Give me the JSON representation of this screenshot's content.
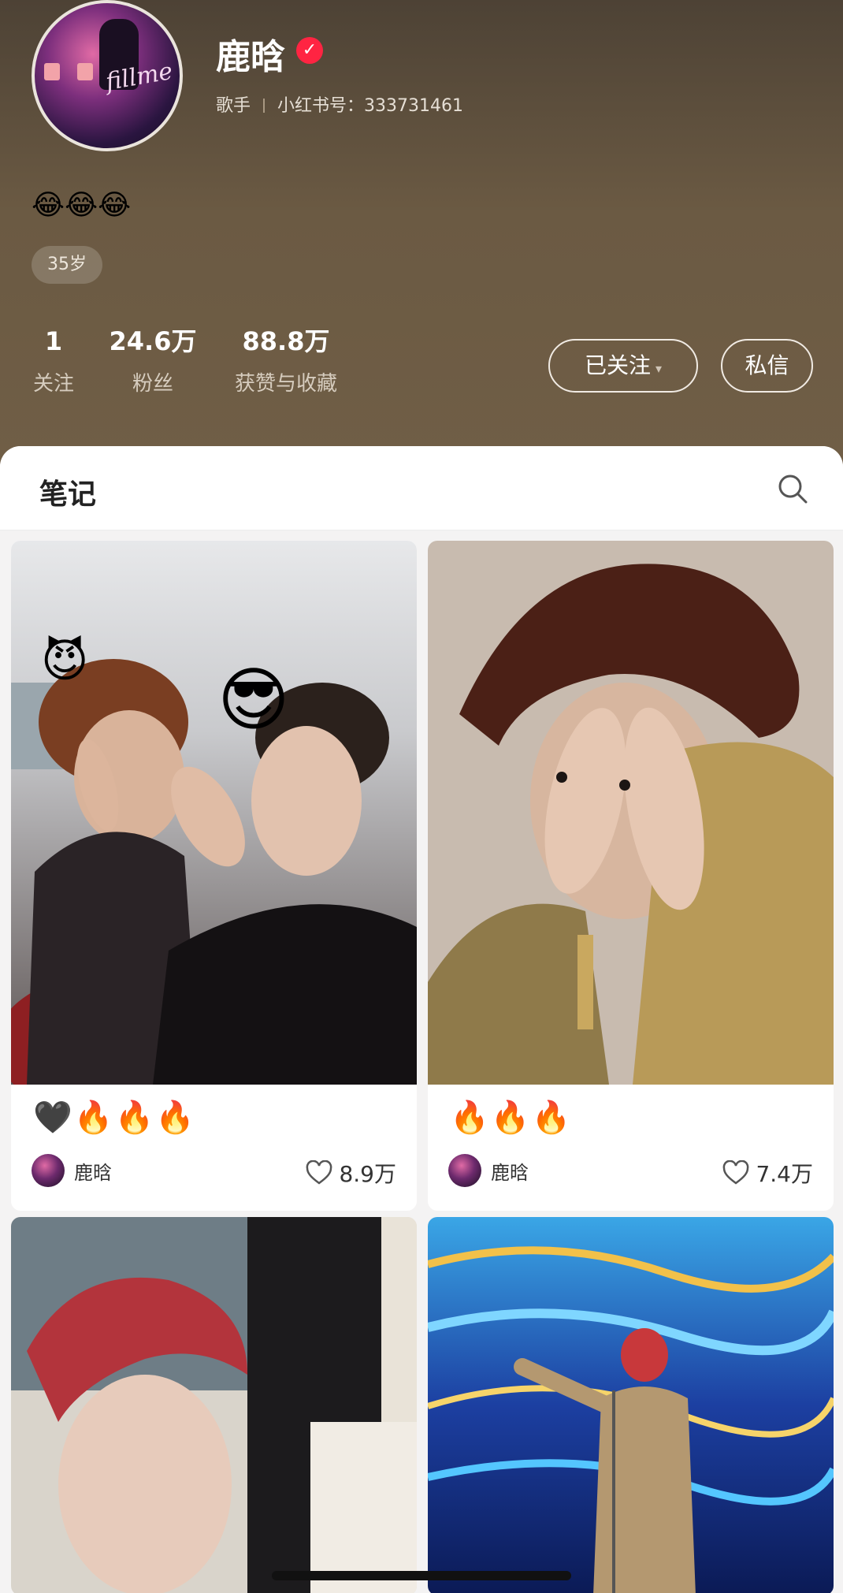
{
  "profile": {
    "name": "鹿晗",
    "verified_icon": "verified-check-icon",
    "role": "歌手",
    "redbook_id_label": "小红书号：",
    "redbook_id": "333731461",
    "avatar_sign_text": "fillme",
    "bio": "😂😂😂",
    "age_tag": "35岁"
  },
  "stats": [
    {
      "value": "1",
      "label": "关注"
    },
    {
      "value": "24.6万",
      "label": "粉丝"
    },
    {
      "value": "88.8万",
      "label": "获赞与收藏"
    }
  ],
  "actions": {
    "follow_label": "已关注",
    "follow_caret": "▾",
    "message_label": "私信"
  },
  "tabs": {
    "notes_label": "笔记",
    "search_icon": "search-icon"
  },
  "notes": [
    {
      "caption": "🖤🔥🔥🔥",
      "author": "鹿晗",
      "likes": "8.9万",
      "cover_emoji_1": "😈",
      "cover_emoji_2": "😎"
    },
    {
      "caption": "🔥🔥🔥",
      "author": "鹿晗",
      "likes": "7.4万"
    },
    {
      "caption": "",
      "author": "",
      "likes": ""
    },
    {
      "caption": "",
      "author": "",
      "likes": ""
    }
  ],
  "colors": {
    "header_top": "#4d4235",
    "header_bottom": "#705e46",
    "verified_red": "#ff2442",
    "sheet_bg": "#f4f3f3"
  }
}
